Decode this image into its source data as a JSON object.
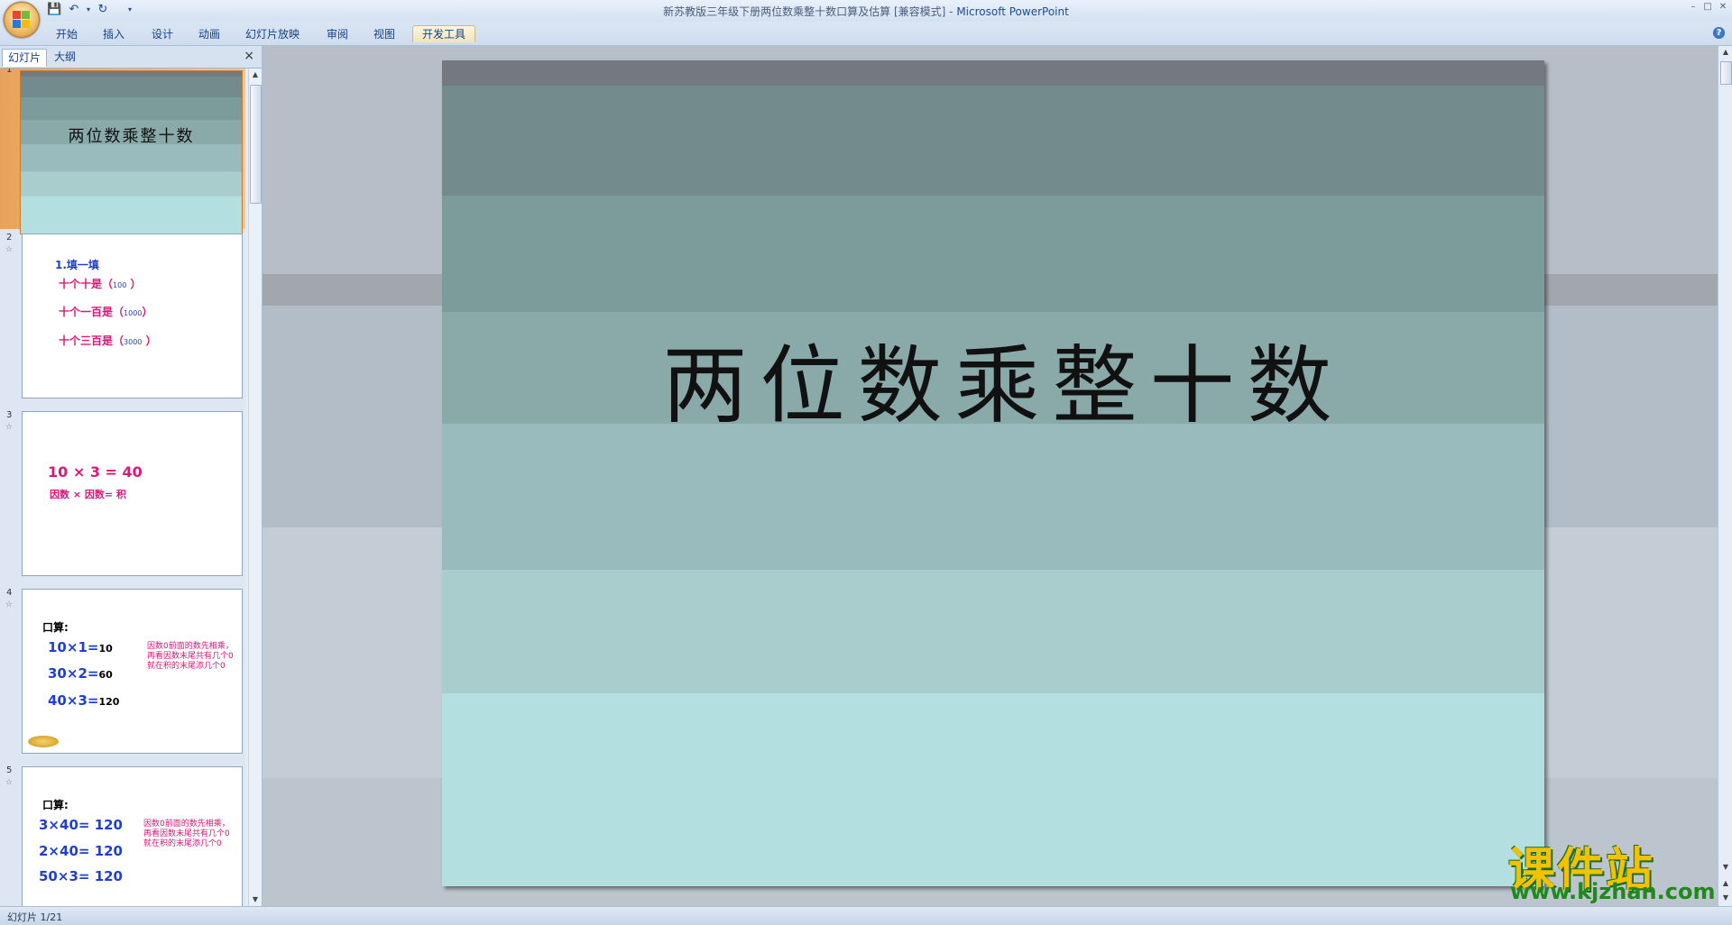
{
  "window": {
    "title": "新苏教版三年级下册两位数乘整十数口算及估算 [兼容模式]",
    "title_sep": " - ",
    "app": "Microsoft PowerPoint"
  },
  "ribbon": {
    "tabs": [
      "开始",
      "插入",
      "设计",
      "动画",
      "幻灯片放映",
      "审阅",
      "视图",
      "开发工具"
    ],
    "active_tab": "开发工具"
  },
  "left_panel": {
    "tabs": [
      "幻灯片",
      "大纲"
    ],
    "active_tab": "幻灯片",
    "close_glyph": "×",
    "slides": [
      {
        "num": "1",
        "title": "两位数乘整十数"
      },
      {
        "num": "2",
        "heading": "1.填一填",
        "lines": [
          {
            "text": "十个十是（",
            "value": "100",
            "close": "）"
          },
          {
            "text": "十个一百是（",
            "value": "1000",
            "close": "）"
          },
          {
            "text": "十个三百是（",
            "value": "3000",
            "close": "）"
          }
        ]
      },
      {
        "num": "3",
        "equation": "10 × 3 = 40",
        "caption": "因数 × 因数= 积"
      },
      {
        "num": "4",
        "heading": "口算:",
        "rows": [
          {
            "expr": "10×1=",
            "result": "10"
          },
          {
            "expr": "30×2=",
            "result": "60"
          },
          {
            "expr": "40×3=",
            "result": "120"
          }
        ],
        "note": "因数0前面的数先相乘，再看因数末尾共有几个0就在积的末尾添几个0"
      },
      {
        "num": "5",
        "heading": "口算:",
        "rows": [
          {
            "expr": "3×40=",
            "result": "120"
          },
          {
            "expr": "2×40=",
            "result": "120"
          },
          {
            "expr": "50×3=",
            "result": "120"
          }
        ],
        "note": "因数0前面的数先相乘，再看因数末尾共有几个0就在积的末尾添几个0"
      }
    ]
  },
  "slide": {
    "title": "两位数乘整十数"
  },
  "status": {
    "text": "幻灯片 1/21"
  },
  "watermark": {
    "cn": "课件站",
    "url": "www.kjzhan.com"
  },
  "colors": {
    "accent_blue": "#1f3fd1",
    "accent_magenta": "#e0157a",
    "slide_bands": [
      "#74797f",
      "#738b8c",
      "#7c9c9b",
      "#8aa9a9",
      "#99bbbd",
      "#a9cccd",
      "#b4dfe1"
    ]
  }
}
